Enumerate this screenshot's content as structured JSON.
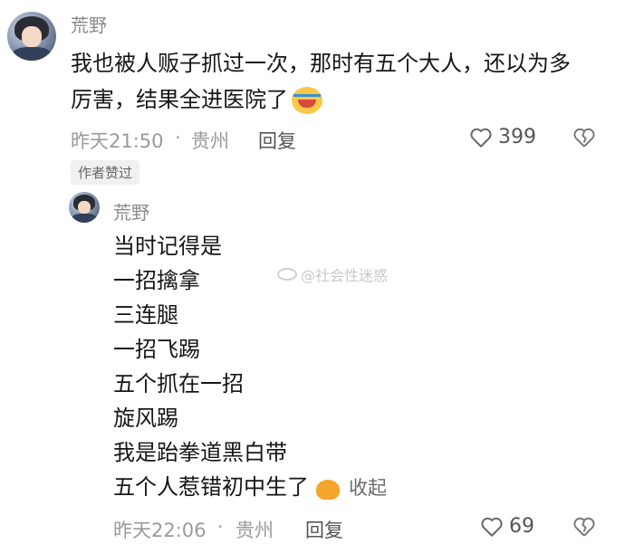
{
  "comment": {
    "username": "荒野",
    "text_line1": "我也被人贩子抓过一次，那时有五个大人，还以为多",
    "text_line2": "厉害，结果全进医院了",
    "emoji": "laughing-crying-icon",
    "time": "昨天21:50",
    "dot": "·",
    "location": "贵州",
    "reply_label": "回复",
    "likes": "399",
    "badge": "作者赞过"
  },
  "reply": {
    "username": "荒野",
    "lines": [
      "当时记得是",
      "一招擒拿",
      "三连腿",
      "一招飞踢",
      "五个抓在一招",
      "旋风踢",
      "我是跆拳道黑白带",
      "五个人惹错初中生了"
    ],
    "emoji": "strong-arm-icon",
    "collapse_label": "收起",
    "time": "昨天22:06",
    "dot": "·",
    "location": "贵州",
    "reply_label": "回复",
    "likes": "69"
  },
  "watermark": "@社会性迷惑",
  "colors": {
    "text": "#161616",
    "meta": "#9a9a9a",
    "username": "#8a8a8a"
  }
}
